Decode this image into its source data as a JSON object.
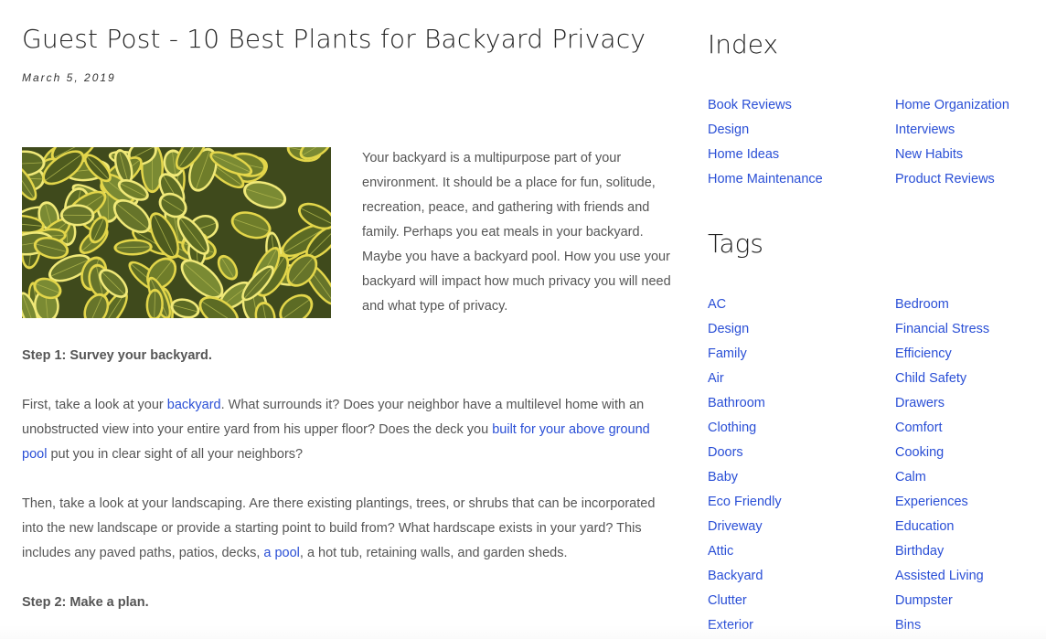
{
  "article": {
    "title": "Guest Post - 10 Best Plants for Backyard Privacy",
    "date": "March 5, 2019",
    "intro": "Your backyard is a multipurpose part of your environment. It should be a place for fun, solitude, recreation, peace, and gathering with friends and family. Perhaps you eat meals in your backyard. Maybe you have a backyard pool. How you use your backyard will impact how much privacy you will need and what type of privacy.",
    "step1_heading": "Step 1: Survey your backyard.",
    "p1": {
      "t1": "First, take a look at your ",
      "link1": "backyard",
      "t2": ". What surrounds it? Does your neighbor have a multilevel home with an unobstructed view into your entire yard from his upper floor? Does the deck you ",
      "link2": "built for your above ground pool",
      "t3": " put you in clear sight of all your neighbors?"
    },
    "p2": {
      "t1": "Then, take a look at your landscaping. Are there existing plantings, trees, or shrubs that can be incorporated into the new landscape or provide a starting point to build from? What hardscape exists in your yard? This includes any paved paths, patios, decks, ",
      "link1": "a pool",
      "t2": ", a hot tub, retaining walls, and garden sheds."
    },
    "step2_heading": "Step 2: Make a plan."
  },
  "sidebar": {
    "index_heading": "Index",
    "index_col1": [
      "Book Reviews",
      "Design",
      "Home Ideas",
      "Home Maintenance"
    ],
    "index_col2": [
      "Home Organization",
      "Interviews",
      "New Habits",
      "Product Reviews"
    ],
    "tags_heading": "Tags",
    "tags_col1": [
      "AC",
      "Design",
      "Family",
      "Air",
      "Bathroom",
      "Clothing",
      "Doors",
      "Baby",
      "Eco Friendly",
      "Driveway",
      "Attic",
      "Backyard",
      "Clutter",
      "Exterior"
    ],
    "tags_col2": [
      "Bedroom",
      "Financial Stress",
      "Efficiency",
      "Child Safety",
      "Drawers",
      "Comfort",
      "Cooking",
      "Calm",
      "Experiences",
      "Education",
      "Birthday",
      "Assisted Living",
      "Dumpster",
      "Bins"
    ]
  },
  "colors": {
    "link": "#2a4fd6",
    "heading": "#222222",
    "body_text": "#555555"
  }
}
